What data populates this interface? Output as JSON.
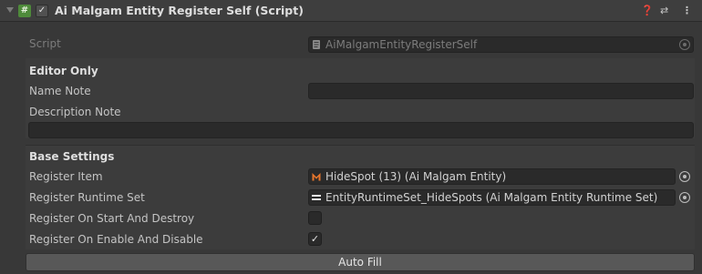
{
  "header": {
    "title": "Ai Malgam Entity Register Self (Script)",
    "enabled": true,
    "icons": [
      "help-icon",
      "settings-sliders-icon",
      "more-vertical-icon"
    ]
  },
  "script_row": {
    "label": "Script",
    "value": "AiMalgamEntityRegisterSelf"
  },
  "editor_only": {
    "heading": "Editor Only",
    "name_note_label": "Name Note",
    "name_note_value": "",
    "description_note_label": "Description Note",
    "description_note_value": ""
  },
  "base_settings": {
    "heading": "Base Settings",
    "register_item_label": "Register Item",
    "register_item_value": "HideSpot (13) (Ai Malgam Entity)",
    "register_runtime_set_label": "Register Runtime Set",
    "register_runtime_set_value": "EntityRuntimeSet_HideSpots (Ai Malgam Entity Runtime Set)",
    "register_on_start_and_destroy_label": "Register On Start And Destroy",
    "register_on_start_and_destroy_checked": false,
    "register_on_enable_and_disable_label": "Register On Enable And Disable",
    "register_on_enable_and_disable_checked": true
  },
  "auto_fill_button": "Auto Fill",
  "colors": {
    "background": "#383838",
    "field": "#2a2a2a",
    "script_icon": "#4e8a3a",
    "malgam_icon": "#e8762c"
  }
}
